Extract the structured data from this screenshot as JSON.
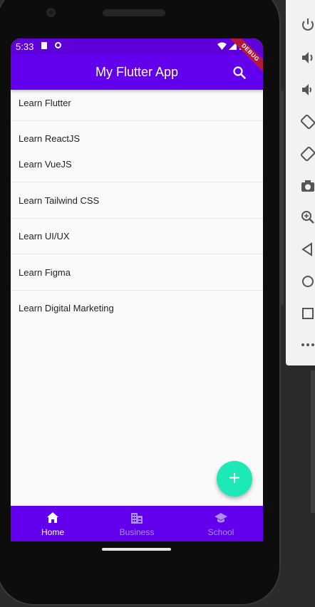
{
  "status_bar": {
    "time": "5:33"
  },
  "app_bar": {
    "title": "My Flutter App",
    "debug_banner": "DEBUG"
  },
  "list": {
    "items": [
      "Learn Flutter",
      "Learn ReactJS",
      "Learn VueJS",
      "Learn Tailwind CSS",
      "Learn UI/UX",
      "Learn Figma",
      "Learn Digital Marketing"
    ]
  },
  "fab": {
    "label": "+"
  },
  "bottom_nav": {
    "items": [
      {
        "label": "Home",
        "icon": "home-icon",
        "active": true
      },
      {
        "label": "Business",
        "icon": "business-icon",
        "active": false
      },
      {
        "label": "School",
        "icon": "school-icon",
        "active": false
      }
    ]
  },
  "emulator_panel": {
    "buttons": [
      "power-icon",
      "volume-up-icon",
      "volume-down-icon",
      "rotate-left-icon",
      "rotate-right-icon",
      "camera-icon",
      "zoom-icon",
      "back-icon",
      "home-circle-icon",
      "overview-icon",
      "more-icon"
    ]
  },
  "colors": {
    "primary": "#6200ee",
    "status_bar": "#5d00d9",
    "fab": "#1de9b6",
    "nav_inactive": "#a98df0",
    "debug": "#b11a3a"
  }
}
